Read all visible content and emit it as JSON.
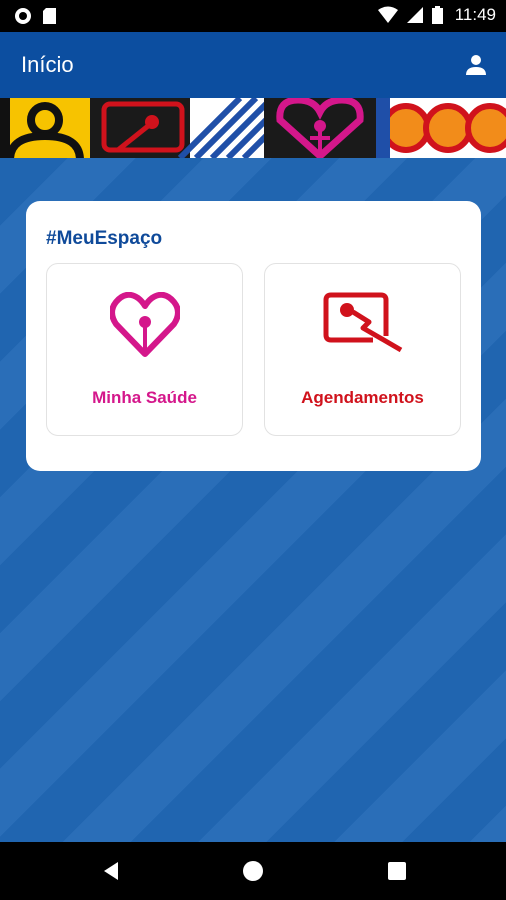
{
  "status_bar": {
    "time": "11:49",
    "icons": [
      "record-icon",
      "sd-card-icon",
      "wifi-icon",
      "signal-icon",
      "battery-icon"
    ]
  },
  "app_bar": {
    "title": "Início",
    "profile_icon": "person-icon"
  },
  "card": {
    "title": "#MeuEspaço",
    "tiles": [
      {
        "label": "Minha Saúde",
        "icon": "heart-pin-icon",
        "color": "#d4178b"
      },
      {
        "label": "Agendamentos",
        "icon": "calendar-pin-icon",
        "color": "#d0121c"
      }
    ]
  },
  "colors": {
    "app_bar": "#0c4ea0",
    "background": "#1f64b0",
    "card_title": "#0f4a9a"
  },
  "nav_bar": {
    "buttons": [
      "back-icon",
      "home-icon",
      "recent-apps-icon"
    ]
  }
}
